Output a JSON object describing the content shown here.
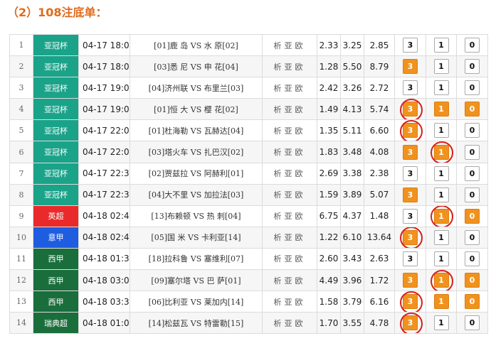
{
  "heading": "（2）108注底单：",
  "colors": {
    "afc": "#1aa389",
    "epl": "#ea2a2a",
    "seriea": "#1f5de0",
    "laliga": "#1a6e3c",
    "allsvenskan": "#1a6e3c",
    "pick_active": "#f0921e",
    "circle": "#d81e1e"
  },
  "rows": [
    {
      "num": "1",
      "league": "亚冠杯",
      "league_color": "#1aa389",
      "time": "04-17 18:00",
      "match": "[01]鹿 岛 VS 水 原[02]",
      "analysis": "析亚欧",
      "o1": "2.33",
      "o2": "3.25",
      "o3": "2.85",
      "picks": [
        {
          "v": "3",
          "on": false,
          "circled": false
        },
        {
          "v": "1",
          "on": false,
          "circled": false
        },
        {
          "v": "0",
          "on": false,
          "circled": false
        }
      ]
    },
    {
      "num": "2",
      "league": "亚冠杯",
      "league_color": "#1aa389",
      "time": "04-17 18:00",
      "match": "[03]悉 尼 VS 申 花[04]",
      "analysis": "析亚欧",
      "o1": "1.28",
      "o2": "5.50",
      "o3": "8.79",
      "picks": [
        {
          "v": "3",
          "on": true,
          "circled": false
        },
        {
          "v": "1",
          "on": false,
          "circled": false
        },
        {
          "v": "0",
          "on": false,
          "circled": false
        }
      ]
    },
    {
      "num": "3",
      "league": "亚冠杯",
      "league_color": "#1aa389",
      "time": "04-17 19:00",
      "match": "[04]济州联 VS 布里兰[03]",
      "analysis": "析亚欧",
      "o1": "2.42",
      "o2": "3.26",
      "o3": "2.72",
      "picks": [
        {
          "v": "3",
          "on": false,
          "circled": false
        },
        {
          "v": "1",
          "on": false,
          "circled": false
        },
        {
          "v": "0",
          "on": false,
          "circled": false
        }
      ]
    },
    {
      "num": "4",
      "league": "亚冠杯",
      "league_color": "#1aa389",
      "time": "04-17 19:00",
      "match": "[01]恒 大 VS 樱 花[02]",
      "analysis": "析亚欧",
      "o1": "1.49",
      "o2": "4.13",
      "o3": "5.74",
      "picks": [
        {
          "v": "3",
          "on": true,
          "circled": true
        },
        {
          "v": "1",
          "on": true,
          "circled": false
        },
        {
          "v": "0",
          "on": true,
          "circled": false
        }
      ]
    },
    {
      "num": "5",
      "league": "亚冠杯",
      "league_color": "#1aa389",
      "time": "04-17 22:00",
      "match": "[01]杜海勒 VS 瓦赫达[04]",
      "analysis": "析亚欧",
      "o1": "1.35",
      "o2": "5.11",
      "o3": "6.60",
      "picks": [
        {
          "v": "3",
          "on": true,
          "circled": true
        },
        {
          "v": "1",
          "on": false,
          "circled": false
        },
        {
          "v": "0",
          "on": false,
          "circled": false
        }
      ]
    },
    {
      "num": "6",
      "league": "亚冠杯",
      "league_color": "#1aa389",
      "time": "04-17 22:00",
      "match": "[03]塔火车 VS 扎巴汉[02]",
      "analysis": "析亚欧",
      "o1": "1.83",
      "o2": "3.48",
      "o3": "4.08",
      "picks": [
        {
          "v": "3",
          "on": true,
          "circled": false
        },
        {
          "v": "1",
          "on": true,
          "circled": true
        },
        {
          "v": "0",
          "on": false,
          "circled": false
        }
      ]
    },
    {
      "num": "7",
      "league": "亚冠杯",
      "league_color": "#1aa389",
      "time": "04-17 22:30",
      "match": "[02]贾兹拉 VS 阿赫利[01]",
      "analysis": "析亚欧",
      "o1": "2.69",
      "o2": "3.38",
      "o3": "2.38",
      "picks": [
        {
          "v": "3",
          "on": false,
          "circled": false
        },
        {
          "v": "1",
          "on": false,
          "circled": false
        },
        {
          "v": "0",
          "on": false,
          "circled": false
        }
      ]
    },
    {
      "num": "8",
      "league": "亚冠杯",
      "league_color": "#1aa389",
      "time": "04-17 22:30",
      "match": "[04]大不里 VS 加拉法[03]",
      "analysis": "析亚欧",
      "o1": "1.59",
      "o2": "3.89",
      "o3": "5.07",
      "picks": [
        {
          "v": "3",
          "on": true,
          "circled": false
        },
        {
          "v": "1",
          "on": false,
          "circled": false
        },
        {
          "v": "0",
          "on": false,
          "circled": false
        }
      ]
    },
    {
      "num": "9",
      "league": "英超",
      "league_color": "#ea2a2a",
      "time": "04-18 02:45",
      "match": "[13]布赖顿 VS 热 刺[04]",
      "analysis": "析亚欧",
      "o1": "6.75",
      "o2": "4.37",
      "o3": "1.48",
      "picks": [
        {
          "v": "3",
          "on": false,
          "circled": false
        },
        {
          "v": "1",
          "on": true,
          "circled": true
        },
        {
          "v": "0",
          "on": true,
          "circled": false
        }
      ]
    },
    {
      "num": "10",
      "league": "意甲",
      "league_color": "#1f5de0",
      "time": "04-18 02:45",
      "match": "[05]国 米 VS 卡利亚[14]",
      "analysis": "析亚欧",
      "o1": "1.22",
      "o2": "6.10",
      "o3": "13.64",
      "picks": [
        {
          "v": "3",
          "on": true,
          "circled": true
        },
        {
          "v": "1",
          "on": false,
          "circled": false
        },
        {
          "v": "0",
          "on": false,
          "circled": false
        }
      ]
    },
    {
      "num": "11",
      "league": "西甲",
      "league_color": "#1a6e3c",
      "time": "04-18 01:30",
      "match": "[18]拉科鲁 VS 塞维利[07]",
      "analysis": "析亚欧",
      "o1": "2.60",
      "o2": "3.43",
      "o3": "2.63",
      "picks": [
        {
          "v": "3",
          "on": false,
          "circled": false
        },
        {
          "v": "1",
          "on": false,
          "circled": false
        },
        {
          "v": "0",
          "on": false,
          "circled": false
        }
      ]
    },
    {
      "num": "12",
      "league": "西甲",
      "league_color": "#1a6e3c",
      "time": "04-18 03:00",
      "match": "[09]塞尔塔 VS 巴 萨[01]",
      "analysis": "析亚欧",
      "o1": "4.49",
      "o2": "3.96",
      "o3": "1.72",
      "picks": [
        {
          "v": "3",
          "on": true,
          "circled": false
        },
        {
          "v": "1",
          "on": true,
          "circled": true
        },
        {
          "v": "0",
          "on": true,
          "circled": false
        }
      ]
    },
    {
      "num": "13",
      "league": "西甲",
      "league_color": "#1a6e3c",
      "time": "04-18 03:30",
      "match": "[06]比利亚 VS 莱加内[14]",
      "analysis": "析亚欧",
      "o1": "1.58",
      "o2": "3.79",
      "o3": "6.16",
      "picks": [
        {
          "v": "3",
          "on": true,
          "circled": true
        },
        {
          "v": "1",
          "on": true,
          "circled": false
        },
        {
          "v": "0",
          "on": true,
          "circled": false
        }
      ]
    },
    {
      "num": "14",
      "league": "瑞典超",
      "league_color": "#1a6e3c",
      "time": "04-18 01:00",
      "match": "[14]松兹瓦 VS 特雷勒[15]",
      "analysis": "析亚欧",
      "o1": "1.70",
      "o2": "3.55",
      "o3": "4.78",
      "picks": [
        {
          "v": "3",
          "on": true,
          "circled": true
        },
        {
          "v": "1",
          "on": false,
          "circled": false
        },
        {
          "v": "0",
          "on": false,
          "circled": false
        }
      ]
    }
  ]
}
